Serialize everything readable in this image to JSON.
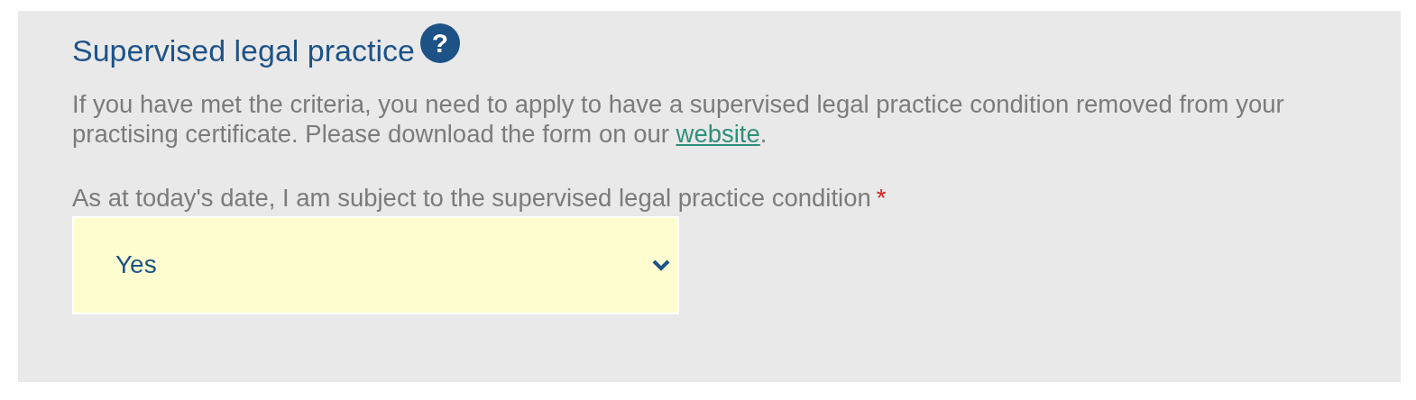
{
  "section": {
    "title": "Supervised legal practice",
    "help_icon": "?",
    "intro": {
      "text_before": "If you have met the criteria, you need to apply to have a supervised legal practice condition removed from your practising certificate. Please download the form on our ",
      "link": "website",
      "text_after": "."
    },
    "question": {
      "label": "As at today's date, I am subject to the supervised legal practice condition",
      "required": true,
      "required_mark": "*"
    },
    "dropdown": {
      "value": "Yes"
    }
  }
}
